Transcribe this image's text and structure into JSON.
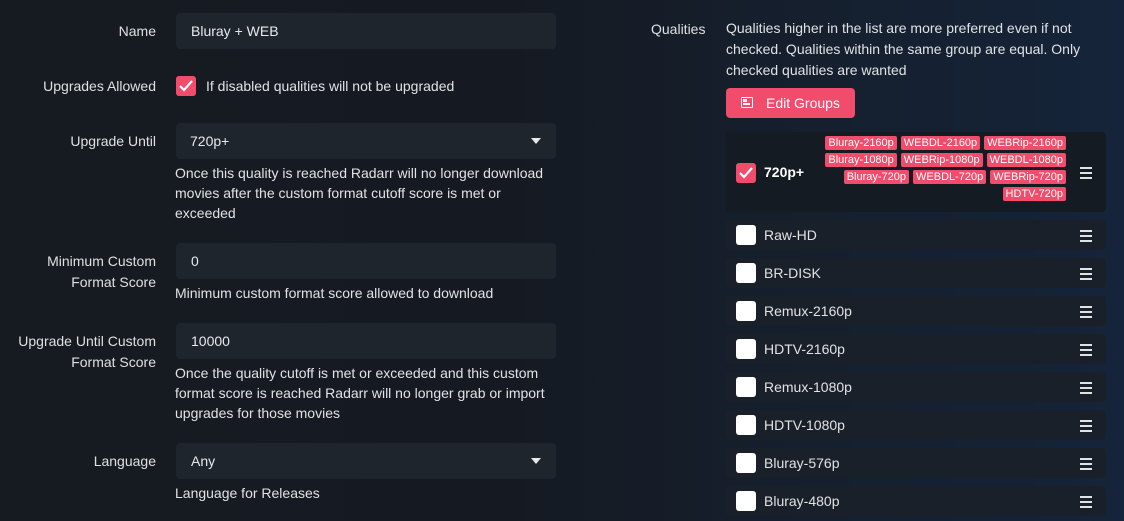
{
  "form": {
    "name": {
      "label": "Name",
      "value": "Bluray + WEB"
    },
    "upgrades_allowed": {
      "label": "Upgrades Allowed",
      "checked": true,
      "help": "If disabled qualities will not be upgraded"
    },
    "upgrade_until": {
      "label": "Upgrade Until",
      "value": "720p+",
      "help": "Once this quality is reached Radarr will no longer download movies after the custom format cutoff score is met or exceeded"
    },
    "min_custom_format_score": {
      "label_line1": "Minimum Custom",
      "label_line2": "Format Score",
      "value": "0",
      "help": "Minimum custom format score allowed to download"
    },
    "upgrade_until_cf_score": {
      "label_line1": "Upgrade Until Custom",
      "label_line2": "Format Score",
      "value": "10000",
      "help": "Once the quality cutoff is met or exceeded and this custom format score is reached Radarr will no longer grab or import upgrades for those movies"
    },
    "language": {
      "label": "Language",
      "value": "Any",
      "help": "Language for Releases"
    }
  },
  "qualities": {
    "label": "Qualities",
    "info": "Qualities higher in the list are more preferred even if not checked. Qualities within the same group are equal. Only checked qualities are wanted",
    "edit_groups_label": "Edit Groups",
    "group": {
      "name": "720p+",
      "checked": true,
      "tags": [
        "Bluray-2160p",
        "WEBDL-2160p",
        "WEBRip-2160p",
        "Bluray-1080p",
        "WEBRip-1080p",
        "WEBDL-1080p",
        "Bluray-720p",
        "WEBDL-720p",
        "WEBRip-720p",
        "HDTV-720p"
      ]
    },
    "items": [
      {
        "name": "Raw-HD",
        "checked": false
      },
      {
        "name": "BR-DISK",
        "checked": false
      },
      {
        "name": "Remux-2160p",
        "checked": false
      },
      {
        "name": "HDTV-2160p",
        "checked": false
      },
      {
        "name": "Remux-1080p",
        "checked": false
      },
      {
        "name": "HDTV-1080p",
        "checked": false
      },
      {
        "name": "Bluray-576p",
        "checked": false
      },
      {
        "name": "Bluray-480p",
        "checked": false
      }
    ]
  },
  "colors": {
    "accent": "#f14c6c",
    "input_bg": "#1f252d",
    "row_bg": "#1a2029"
  }
}
